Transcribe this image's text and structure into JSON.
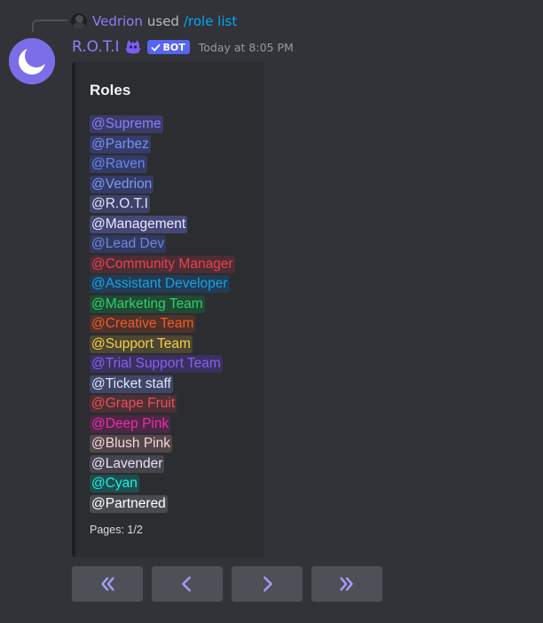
{
  "reply": {
    "user": "Vedrion",
    "used": "used",
    "command": "/role list"
  },
  "message": {
    "username": "R.O.T.I",
    "bot_tag": "BOT",
    "timestamp": "Today at 8:05 PM",
    "avatar_icon": "moon-avatar-icon",
    "badge_icon": "purple-creature-icon"
  },
  "embed": {
    "title": "Roles",
    "footer": "Pages: 1/2",
    "roles": [
      {
        "label": "@Supreme",
        "color": "#8b7ff7",
        "bg": "#3b3b6a"
      },
      {
        "label": "@Parbez",
        "color": "#7b8ef4",
        "bg": "#363c68"
      },
      {
        "label": "@Raven",
        "color": "#6a86ef",
        "bg": "#333b66"
      },
      {
        "label": "@Vedrion",
        "color": "#7d9bf0",
        "bg": "#333b66"
      },
      {
        "label": "@R.O.T.I",
        "color": "#dde1ff",
        "bg": "#3f4268"
      },
      {
        "label": "@Management",
        "color": "#e8e9ff",
        "bg": "#454775"
      },
      {
        "label": "@Lead Dev",
        "color": "#6f86e0",
        "bg": "#32395e"
      },
      {
        "label": "@Community Manager",
        "color": "#e8424c",
        "bg": "#4d2d34"
      },
      {
        "label": "@Assistant Developer",
        "color": "#1aa0e8",
        "bg": "#203d54"
      },
      {
        "label": "@Marketing Team",
        "color": "#2ed06a",
        "bg": "#214a35"
      },
      {
        "label": "@Creative Team",
        "color": "#f05a2a",
        "bg": "#4f3229"
      },
      {
        "label": "@Support Team",
        "color": "#f5cf4a",
        "bg": "#4d4632"
      },
      {
        "label": "@Trial Support Team",
        "color": "#8a5ff0",
        "bg": "#3a3160"
      },
      {
        "label": "@Ticket staff",
        "color": "#dbe4ff",
        "bg": "#404766"
      },
      {
        "label": "@Grape Fruit",
        "color": "#e8505a",
        "bg": "#4d2f36"
      },
      {
        "label": "@Deep Pink",
        "color": "#f02aae",
        "bg": "#4d2845"
      },
      {
        "label": "@Blush Pink",
        "color": "#fad2dc",
        "bg": "#514649"
      },
      {
        "label": "@Lavender",
        "color": "#e8e0f4",
        "bg": "#45444d"
      },
      {
        "label": "@Cyan",
        "color": "#1af0e4",
        "bg": "#1f4d4e"
      },
      {
        "label": "@Partnered",
        "color": "#ffffff",
        "bg": "#4a4b50"
      }
    ]
  },
  "buttons": [
    {
      "name": "first-page-button",
      "icon": "double-chevron-left-icon"
    },
    {
      "name": "previous-page-button",
      "icon": "chevron-left-icon"
    },
    {
      "name": "next-page-button",
      "icon": "chevron-right-icon"
    },
    {
      "name": "last-page-button",
      "icon": "double-chevron-right-icon"
    }
  ],
  "colors": {
    "background": "#313338",
    "embed_bg": "#2b2d31",
    "username": "#8b80f9",
    "bot_tag": "#5865f2",
    "button_bg": "#4e5058",
    "button_icon": "#a59df8"
  }
}
